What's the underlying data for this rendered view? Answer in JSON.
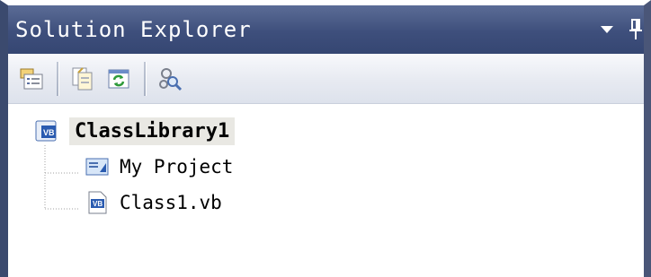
{
  "panel": {
    "title": "Solution Explorer",
    "colors": {
      "titlebar": "#3e4f7c",
      "title_text": "#ffffff",
      "toolbar": "#e7eaf1",
      "root_highlight": "#e9e8e3"
    }
  },
  "title_controls": [
    {
      "name": "dropdown-arrow-icon"
    },
    {
      "name": "pin-icon"
    }
  ],
  "toolbar": {
    "buttons": [
      {
        "name": "properties-icon"
      },
      {
        "name": "show-all-files-icon"
      },
      {
        "name": "refresh-icon"
      },
      {
        "name": "class-view-icon"
      }
    ]
  },
  "tree": {
    "root": {
      "label": "ClassLibrary1",
      "icon": "vb-project-icon"
    },
    "children": [
      {
        "label": "My Project",
        "icon": "my-project-icon"
      },
      {
        "label": "Class1.vb",
        "icon": "vb-file-icon"
      }
    ]
  }
}
